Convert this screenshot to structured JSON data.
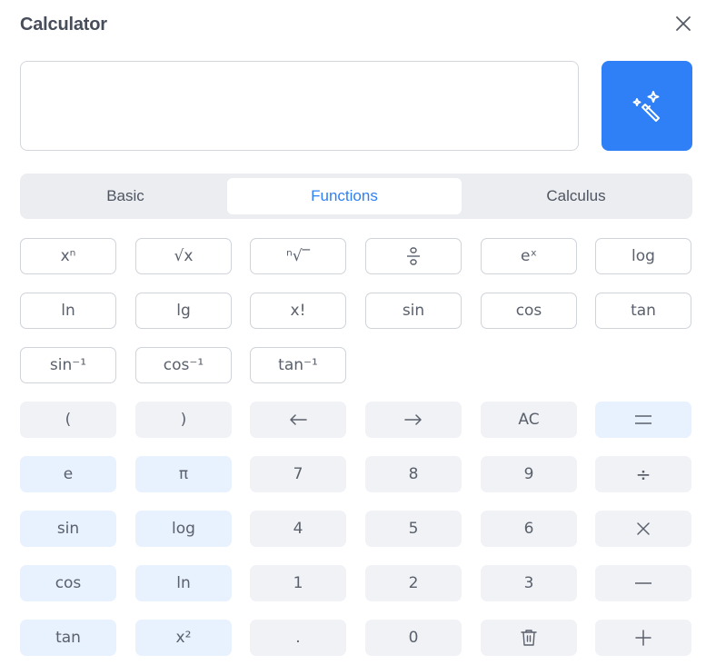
{
  "app": {
    "title": "Calculator"
  },
  "display": {
    "value": ""
  },
  "tabs": [
    {
      "label": "Basic",
      "active": false
    },
    {
      "label": "Functions",
      "active": true
    },
    {
      "label": "Calculus",
      "active": false
    }
  ],
  "function_keys": [
    [
      "xⁿ",
      "√x",
      "ⁿ√‾",
      "fraction",
      "eˣ",
      "log"
    ],
    [
      "ln",
      "lg",
      "x!",
      "sin",
      "cos",
      "tan"
    ],
    [
      "sin⁻¹",
      "cos⁻¹",
      "tan⁻¹"
    ]
  ],
  "keypad": {
    "row1": [
      "(",
      ")",
      "←",
      "→",
      "AC",
      "="
    ],
    "row2": [
      "e",
      "π",
      "7",
      "8",
      "9",
      "÷"
    ],
    "row3": [
      "sin",
      "log",
      "4",
      "5",
      "6",
      "×"
    ],
    "row4": [
      "cos",
      "ln",
      "1",
      "2",
      "3",
      "−"
    ],
    "row5": [
      "tan",
      "x²",
      ".",
      "0",
      "clear",
      "+"
    ]
  },
  "colors": {
    "accent": "#2f80f6",
    "tint": "#e8f1fe",
    "plain": "#f0f2f5"
  }
}
